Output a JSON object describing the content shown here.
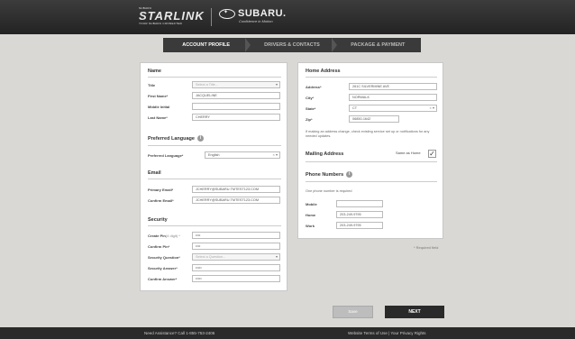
{
  "header": {
    "starlink_top": "SUBARU",
    "starlink_word": "STARLINK",
    "starlink_tag": "YOUR SUBARU CONNECTED",
    "subaru_word": "SUBARU.",
    "subaru_tag": "Confidence in Motion"
  },
  "steps": [
    "ACCOUNT PROFILE",
    "DRIVERS & CONTACTS",
    "PACKAGE & PAYMENT"
  ],
  "left": {
    "name": {
      "title": "Name",
      "title_label": "Title",
      "title_placeholder": "Select a Title...",
      "first_label": "First Name*",
      "first_value": "JACQUELINE",
      "middle_label": "Middle Initial",
      "middle_value": "",
      "last_label": "Last Name*",
      "last_value": "CHERRY"
    },
    "language": {
      "title": "Preferred Language",
      "label": "Preferred Language*",
      "value": "English"
    },
    "email": {
      "title": "Email",
      "primary_label": "Primary Email*",
      "primary_value": "JCHERRY@SUBARU.TMTEST123.COM",
      "confirm_label": "Confirm Email*",
      "confirm_value": "JCHERRY@SUBARU.TMTEST123.COM"
    },
    "security": {
      "title": "Security",
      "pin_label": "Create Pin",
      "pin_hint": "(4 digit) *",
      "pin_value": "••••",
      "confirm_pin_label": "Confirm Pin*",
      "confirm_pin_value": "••••",
      "question_label": "Security Question*",
      "question_placeholder": "Select a Question...",
      "answer_label": "Security Answer*",
      "answer_value": "•••••",
      "confirm_answer_label": "Confirm Answer*",
      "confirm_answer_value": "•••••"
    }
  },
  "right": {
    "address": {
      "title": "Home Address",
      "address_label": "Address*",
      "address_value": "261C SILVERMINE AVE",
      "city_label": "City*",
      "city_value": "NORWALK",
      "state_label": "State*",
      "state_value": "CT",
      "zip_label": "Zip*",
      "zip_value": "06850-1642",
      "note": "If making an address change, check existing service set up or notifications for any needed updates."
    },
    "mailing": {
      "title": "Mailing Address",
      "same_label": "Same as Home",
      "checked": true
    },
    "phone": {
      "title": "Phone Numbers",
      "note": "One phone number is required",
      "mobile_label": "Mobile",
      "mobile_value": "",
      "home_label": "Home",
      "home_value": "203-249-9795",
      "work_label": "Work",
      "work_value": "203-249-9795"
    }
  },
  "required_note": "* Required field",
  "buttons": {
    "save": "Save",
    "next": "NEXT"
  },
  "footer": {
    "assist": "Need Assistance? Call 1-855-753-2406",
    "links": "Website Terms of Use  |  Your Privacy Rights"
  }
}
